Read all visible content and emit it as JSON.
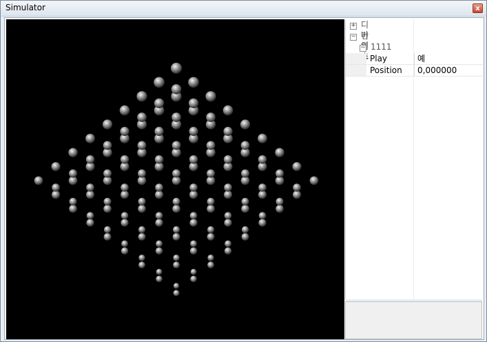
{
  "window": {
    "title": "Simulator",
    "close_label": "x"
  },
  "tree": {
    "devices_label": "디바이스",
    "contents_label": "컨텐츠",
    "content_item_label": "1111"
  },
  "properties": [
    {
      "name": "Play",
      "value": "예"
    },
    {
      "name": "Position",
      "value": "0,000000"
    }
  ],
  "colors": {
    "viewport_bg": "#000000",
    "sphere": "#9a9a9a"
  }
}
